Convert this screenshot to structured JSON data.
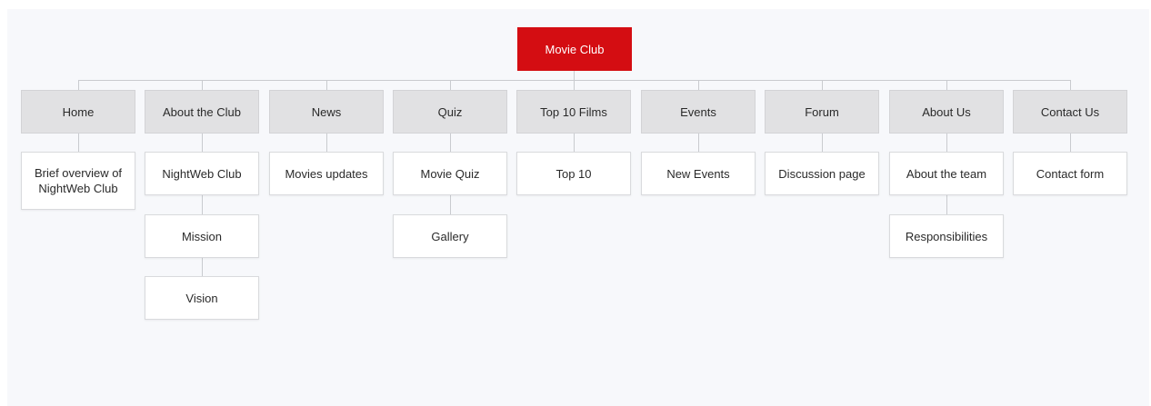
{
  "root": {
    "label": "Movie Club",
    "color": "#d40d12"
  },
  "sections": [
    {
      "label": "Home",
      "children": [
        "Brief overview of NightWeb Club"
      ]
    },
    {
      "label": "About the Club",
      "children": [
        "NightWeb Club",
        "Mission",
        "Vision"
      ]
    },
    {
      "label": "News",
      "children": [
        "Movies updates"
      ]
    },
    {
      "label": "Quiz",
      "children": [
        "Movie Quiz",
        "Gallery"
      ]
    },
    {
      "label": "Top 10 Films",
      "children": [
        "Top 10"
      ]
    },
    {
      "label": "Events",
      "children": [
        "New Events"
      ]
    },
    {
      "label": "Forum",
      "children": [
        "Discussion page"
      ]
    },
    {
      "label": "About Us",
      "children": [
        "About the team",
        "Responsibilities"
      ]
    },
    {
      "label": "Contact Us",
      "children": [
        "Contact form"
      ]
    }
  ]
}
